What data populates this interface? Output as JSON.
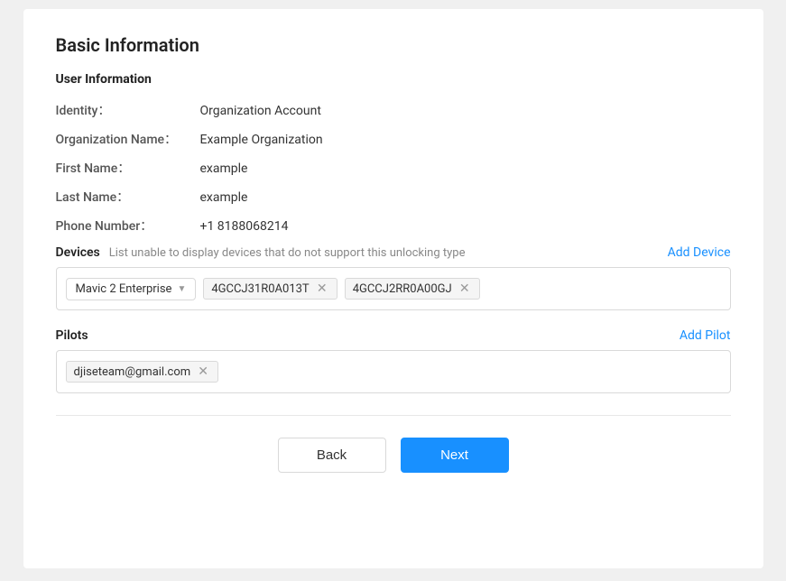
{
  "page": {
    "section_title": "Basic Information",
    "user_info_label": "User Information",
    "fields": {
      "identity_label": "Identity：",
      "identity_value": "Organization Account",
      "org_name_label": "Organization Name：",
      "org_name_value": "Example Organization",
      "first_name_label": "First Name：",
      "first_name_value": "example",
      "last_name_label": "Last Name：",
      "last_name_value": "example",
      "phone_label": "Phone Number：",
      "phone_value": "+1 8188068214"
    },
    "devices": {
      "label": "Devices",
      "hint": "List unable to display devices that do not support this unlocking type",
      "add_link": "Add Device",
      "dropdown_value": "Mavic 2 Enterprise",
      "tags": [
        {
          "id": "tag-1",
          "value": "4GCCJ31R0A013T"
        },
        {
          "id": "tag-2",
          "value": "4GCCJ2RR0A00GJ"
        }
      ]
    },
    "pilots": {
      "label": "Pilots",
      "add_link": "Add Pilot",
      "tags": [
        {
          "id": "pilot-tag-1",
          "value": "djiseteam@gmail.com"
        }
      ]
    },
    "buttons": {
      "back_label": "Back",
      "next_label": "Next"
    }
  }
}
